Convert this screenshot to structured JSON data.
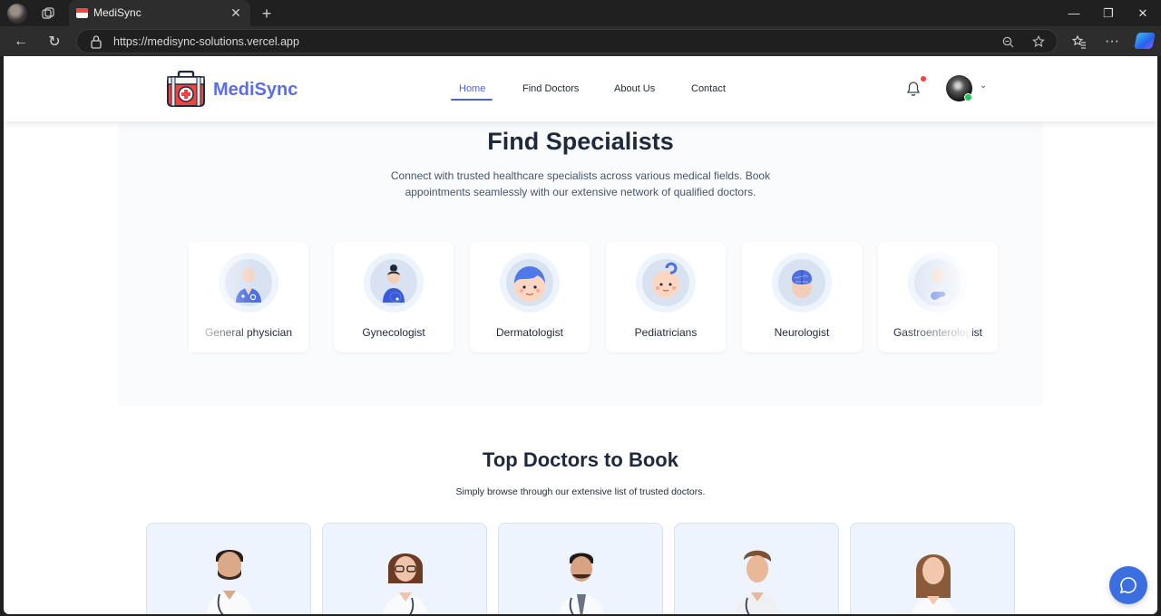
{
  "browser": {
    "tab_title": "MediSync",
    "url": "https://medisync-solutions.vercel.app",
    "new_tab_glyph": "+",
    "close_glyph": "✕",
    "win_min": "—",
    "win_max": "❐",
    "win_close": "✕",
    "back_glyph": "←",
    "reload_glyph": "↻",
    "menu_glyph": "···",
    "chev_glyph": "⌄"
  },
  "header": {
    "brand": "MediSync",
    "nav": [
      {
        "label": "Home",
        "active": true
      },
      {
        "label": "Find Doctors",
        "active": false
      },
      {
        "label": "About Us",
        "active": false
      },
      {
        "label": "Contact",
        "active": false
      }
    ]
  },
  "specialists": {
    "title": "Find Specialists",
    "description": "Connect with trusted healthcare specialists across various medical fields. Book appointments seamlessly with our extensive network of qualified doctors.",
    "items": [
      {
        "label": "General physician",
        "icon": "general-physician-icon"
      },
      {
        "label": "Gynecologist",
        "icon": "gynecologist-icon"
      },
      {
        "label": "Dermatologist",
        "icon": "dermatologist-icon"
      },
      {
        "label": "Pediatricians",
        "icon": "pediatricians-icon"
      },
      {
        "label": "Neurologist",
        "icon": "neurologist-icon"
      },
      {
        "label": "Gastroenterologist",
        "icon": "gastroenterologist-icon"
      }
    ]
  },
  "top_doctors": {
    "title": "Top Doctors to Book",
    "subtitle": "Simply browse through our extensive list of trusted doctors."
  },
  "colors": {
    "brand": "#5b6ee8",
    "nav_active": "#4f5fd9",
    "chat_fab": "#3b6fe0",
    "status_online": "#22c55e",
    "notification_dot": "#ef4444"
  }
}
